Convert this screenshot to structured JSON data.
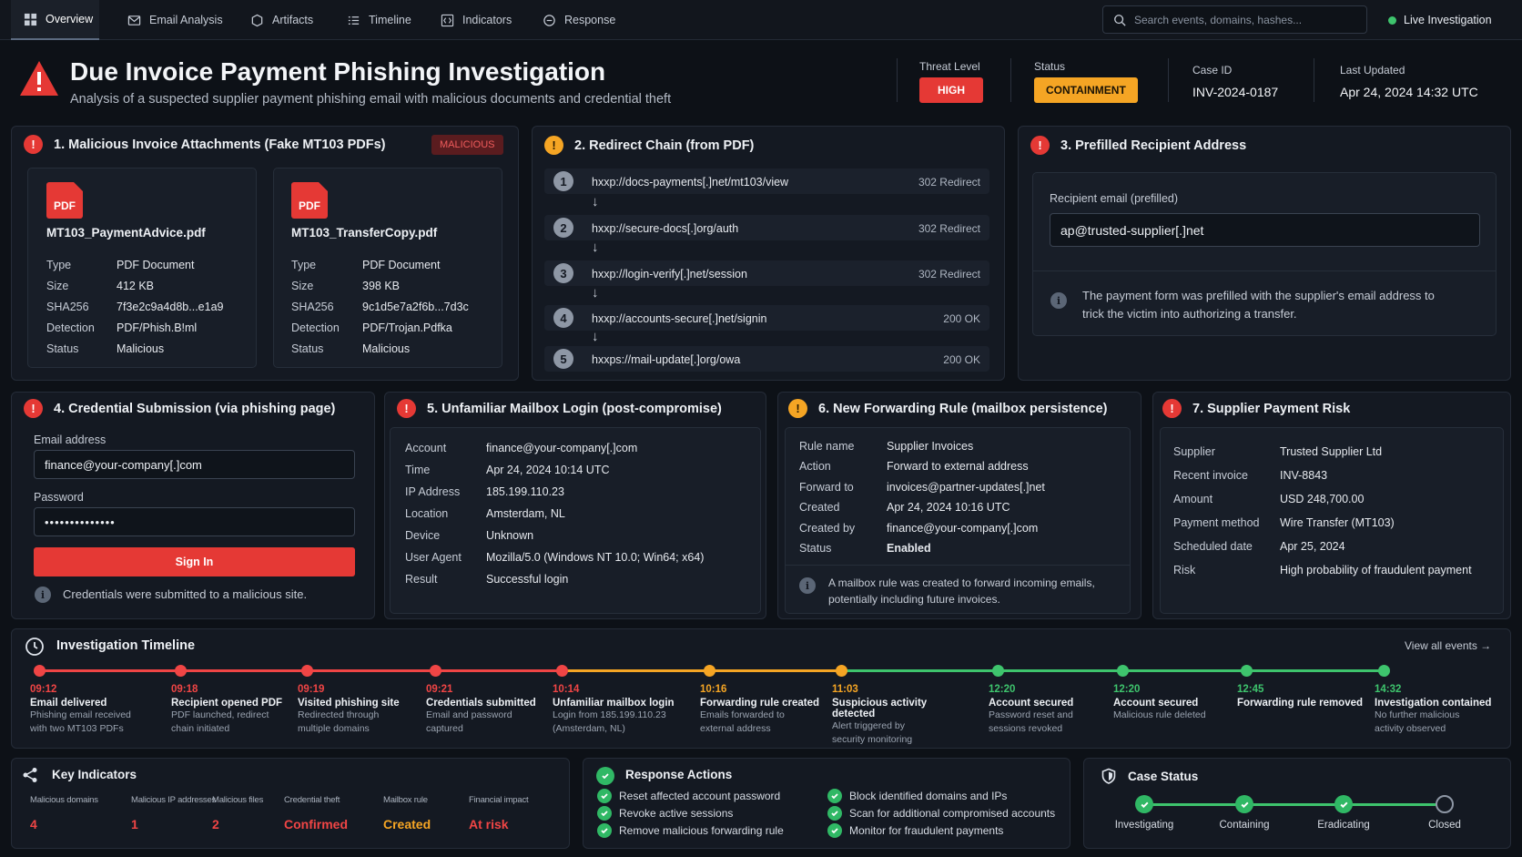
{
  "nav": {
    "tabs": [
      "Overview",
      "Email Analysis",
      "Artifacts",
      "Timeline",
      "Indicators",
      "Response"
    ],
    "search_placeholder": "Search events, domains, hashes...",
    "live_label": "Live Investigation"
  },
  "header": {
    "title": "Due Invoice Payment Phishing Investigation",
    "subtitle": "Analysis of a suspected supplier payment phishing email with malicious documents and credential theft",
    "threat_level_label": "Threat Level",
    "threat_level": "HIGH",
    "status_label": "Status",
    "status": "CONTAINMENT",
    "case_id_label": "Case ID",
    "case_id": "INV-2024-0187",
    "last_updated_label": "Last Updated",
    "last_updated": "Apr 24, 2024 14:32 UTC"
  },
  "attachments": {
    "title": "1. Malicious Invoice Attachments (Fake MT103 PDFs)",
    "badge": "MALICIOUS",
    "icon_label": "PDF",
    "field_labels": [
      "Type",
      "Size",
      "SHA256",
      "Detection",
      "Status"
    ],
    "files": [
      {
        "name": "MT103_PaymentAdvice.pdf",
        "type": "PDF Document",
        "size": "412 KB",
        "sha256": "7f3e2c9a4d8b...e1a9",
        "detection": "PDF/Phish.B!ml",
        "status": "Malicious"
      },
      {
        "name": "MT103_TransferCopy.pdf",
        "type": "PDF Document",
        "size": "398 KB",
        "sha256": "9c1d5e7a2f6b...7d3c",
        "detection": "PDF/Trojan.Pdfka",
        "status": "Malicious"
      }
    ]
  },
  "redirect": {
    "title": "2. Redirect Chain (from PDF)",
    "steps": [
      {
        "num": "1",
        "url": "hxxp://docs-payments[.]net/mt103/view",
        "code": "302 Redirect"
      },
      {
        "num": "2",
        "url": "hxxp://secure-docs[.]org/auth",
        "code": "302 Redirect"
      },
      {
        "num": "3",
        "url": "hxxp://login-verify[.]net/session",
        "code": "302 Redirect"
      },
      {
        "num": "4",
        "url": "hxxp://accounts-secure[.]net/signin",
        "code": "200 OK"
      },
      {
        "num": "5",
        "url": "hxxps://mail-update[.]org/owa",
        "code": "200 OK"
      }
    ]
  },
  "recipient": {
    "title": "3. Prefilled Recipient Address",
    "label": "Recipient email (prefilled)",
    "value": "ap@trusted-supplier[.]net",
    "note": "The payment form was prefilled with the supplier's email address to trick the victim into authorizing a transfer."
  },
  "credential": {
    "title": "4. Credential Submission (via phishing page)",
    "email_label": "Email address",
    "email_value": "finance@your-company[.]com",
    "password_label": "Password",
    "password_value": "••••••••••••••",
    "button": "Sign In",
    "note": "Credentials were submitted to a malicious site."
  },
  "login": {
    "title": "5. Unfamiliar Mailbox Login (post-compromise)",
    "rows": [
      {
        "k": "Account",
        "v": "finance@your-company[.]com"
      },
      {
        "k": "Time",
        "v": "Apr 24, 2024 10:14 UTC"
      },
      {
        "k": "IP Address",
        "v": "185.199.110.23"
      },
      {
        "k": "Location",
        "v": "Amsterdam, NL"
      },
      {
        "k": "Device",
        "v": "Unknown"
      },
      {
        "k": "User Agent",
        "v": "Mozilla/5.0 (Windows NT 10.0; Win64; x64)"
      },
      {
        "k": "Result",
        "v": "Successful login"
      }
    ]
  },
  "forwarding": {
    "title": "6. New Forwarding Rule (mailbox persistence)",
    "rows": [
      {
        "k": "Rule name",
        "v": "Supplier Invoices"
      },
      {
        "k": "Action",
        "v": "Forward to external address"
      },
      {
        "k": "Forward to",
        "v": "invoices@partner-updates[.]net"
      },
      {
        "k": "Created",
        "v": "Apr 24, 2024 10:16 UTC"
      },
      {
        "k": "Created by",
        "v": "finance@your-company[.]com"
      },
      {
        "k": "Status",
        "v": "Enabled"
      }
    ],
    "note": "A mailbox rule was created to forward incoming emails, potentially including future invoices."
  },
  "supplier": {
    "title": "7. Supplier Payment Risk",
    "rows": [
      {
        "k": "Supplier",
        "v": "Trusted Supplier Ltd"
      },
      {
        "k": "Recent invoice",
        "v": "INV-8843"
      },
      {
        "k": "Amount",
        "v": "USD 248,700.00"
      },
      {
        "k": "Payment method",
        "v": "Wire Transfer (MT103)"
      },
      {
        "k": "Scheduled date",
        "v": "Apr 25, 2024"
      },
      {
        "k": "Risk",
        "v": "High probability of fraudulent payment"
      }
    ]
  },
  "timeline": {
    "title": "Investigation Timeline",
    "view_all": "View all events",
    "events": [
      {
        "time": "09:12",
        "title": "Email delivered",
        "desc": [
          "Phishing email received",
          "with two MT103 PDFs"
        ],
        "color": "#f04545"
      },
      {
        "time": "09:18",
        "title": "Recipient opened PDF",
        "desc": [
          "PDF launched, redirect",
          "chain initiated"
        ],
        "color": "#f04545"
      },
      {
        "time": "09:19",
        "title": "Visited phishing site",
        "desc": [
          "Redirected through",
          "multiple domains"
        ],
        "color": "#f04545"
      },
      {
        "time": "09:21",
        "title": "Credentials submitted",
        "desc": [
          "Email and password",
          "captured"
        ],
        "color": "#f04545"
      },
      {
        "time": "10:14",
        "title": "Unfamiliar mailbox login",
        "desc": [
          "Login from 185.199.110.23",
          "(Amsterdam, NL)"
        ],
        "color": "#f04545"
      },
      {
        "time": "10:16",
        "title": "Forwarding rule created",
        "desc": [
          "Emails forwarded to",
          "external address"
        ],
        "color": "#f5a524"
      },
      {
        "time": "11:03",
        "title": "Suspicious activity detected",
        "desc": [
          "Alert triggered by",
          "security monitoring"
        ],
        "color": "#f5a524"
      },
      {
        "time": "12:20",
        "title": "Account secured",
        "desc": [
          "Password reset and",
          "sessions revoked"
        ],
        "color": "#3ec46d"
      },
      {
        "time": "12:20",
        "title": "Account secured",
        "desc": [
          "Malicious rule deleted"
        ],
        "color": "#3ec46d"
      },
      {
        "time": "12:45",
        "title": "Forwarding rule removed",
        "desc": [],
        "color": "#3ec46d"
      },
      {
        "time": "14:32",
        "title": "Investigation contained",
        "desc": [
          "No further malicious",
          "activity observed"
        ],
        "color": "#3ec46d"
      }
    ]
  },
  "indicators": {
    "title": "Key Indicators",
    "items": [
      {
        "label": "Malicious domains",
        "value": "4",
        "color": "#f04545"
      },
      {
        "label": "Malicious IP addresses",
        "value": "1",
        "color": "#f04545"
      },
      {
        "label": "Malicious files",
        "value": "2",
        "color": "#f04545"
      },
      {
        "label": "Credential theft",
        "value": "Confirmed",
        "color": "#f04545"
      },
      {
        "label": "Mailbox rule",
        "value": "Created",
        "color": "#f5a524"
      },
      {
        "label": "Financial impact",
        "value": "At risk",
        "color": "#f04545"
      }
    ]
  },
  "response": {
    "title": "Response Actions",
    "left": [
      "Reset affected account password",
      "Revoke active sessions",
      "Remove malicious forwarding rule"
    ],
    "right": [
      "Block identified domains and IPs",
      "Scan for additional compromised accounts",
      "Monitor for fraudulent payments"
    ]
  },
  "case_status": {
    "title": "Case Status",
    "steps": [
      "Investigating",
      "Containing",
      "Eradicating",
      "Closed"
    ],
    "completed": 3
  },
  "colors": {
    "accent_red": "#e53935",
    "accent_orange": "#f5a524",
    "accent_green": "#3ec46d",
    "background": "#0d1117"
  }
}
